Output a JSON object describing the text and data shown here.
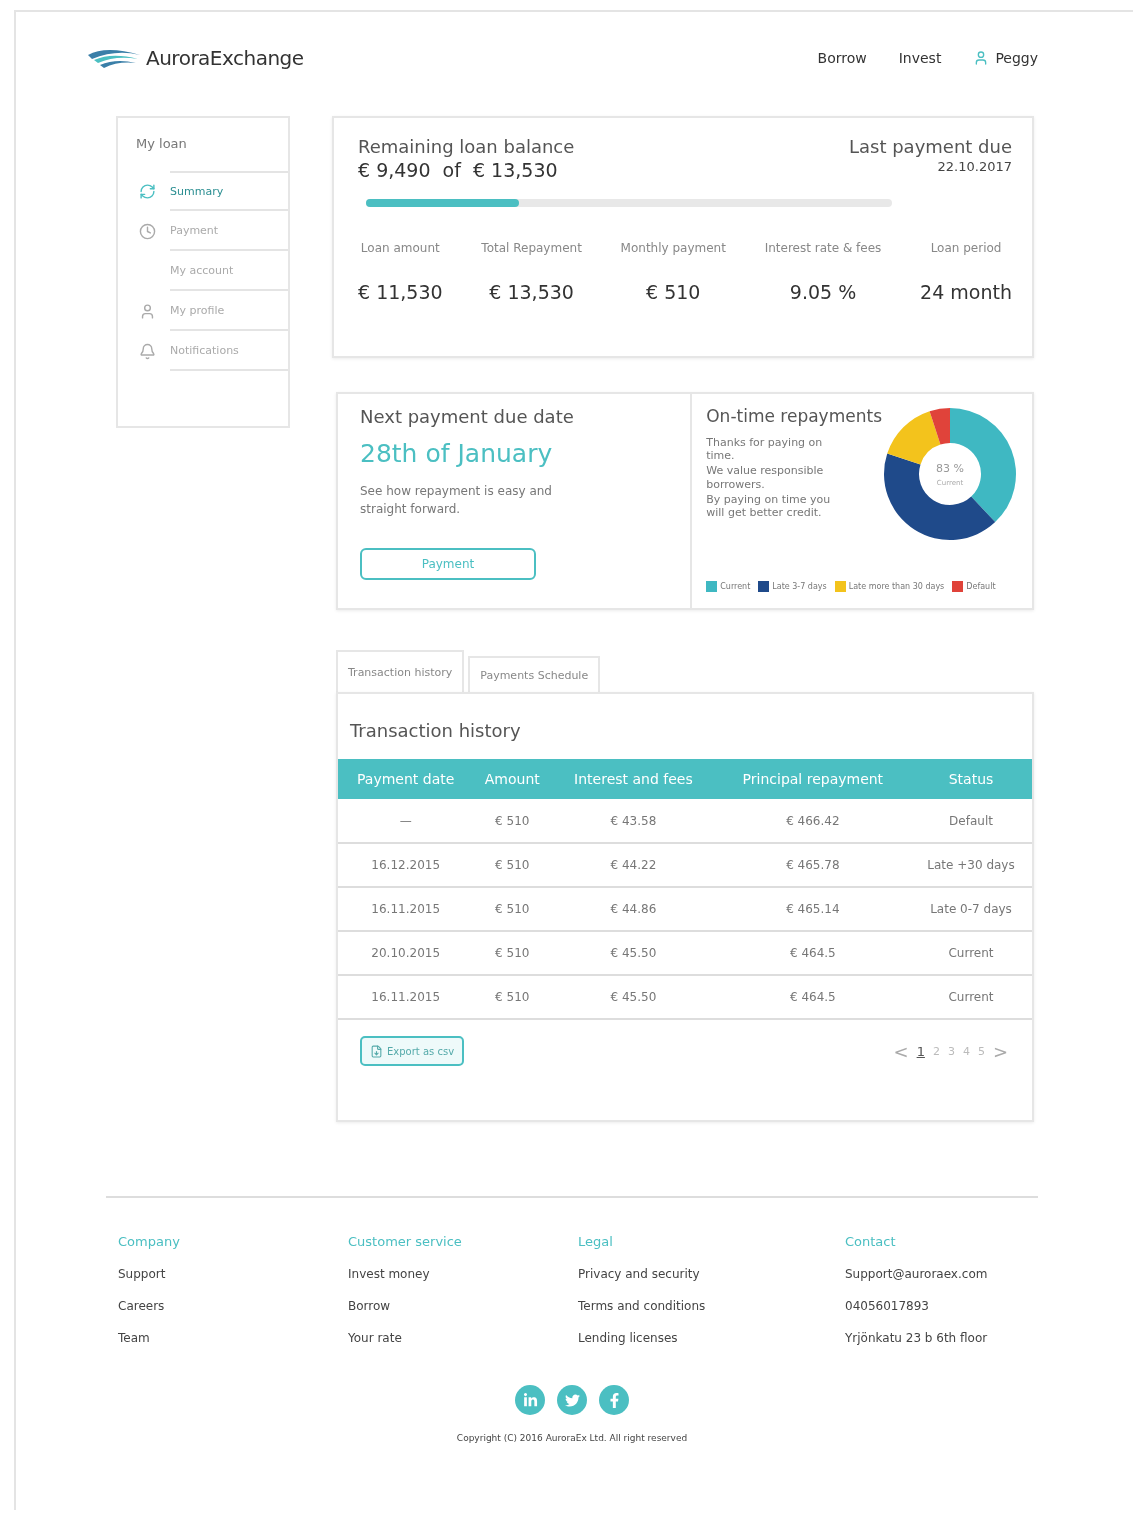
{
  "header": {
    "logo": "AuroraExchange",
    "nav": [
      {
        "label": "Borrow"
      },
      {
        "label": "Invest"
      }
    ],
    "user": "Peggy"
  },
  "sidebar": {
    "title": "My loan",
    "items": [
      {
        "label": "Summary",
        "selected": true,
        "kind": "refresh"
      },
      {
        "label": "Payment",
        "selected": false,
        "kind": "clock"
      },
      {
        "label": "My account",
        "selected": false,
        "kind": "none"
      },
      {
        "label": "My profile",
        "selected": false,
        "kind": "user"
      },
      {
        "label": "Notifications",
        "selected": false,
        "kind": "bell"
      }
    ]
  },
  "loan": {
    "balance_label": "Remaining loan balance",
    "balance": "€ 9,490  of  € 13,530",
    "due_label": "Last payment due",
    "due_date": "22.10.2017",
    "progress": {
      "level": 0.29
    },
    "stats": [
      {
        "label": "Loan amount",
        "value": "€ 11,530"
      },
      {
        "label": "Total Repayment",
        "value": "€ 13,530"
      },
      {
        "label": "Monthly payment",
        "value": "€ 510"
      },
      {
        "label": "Interest rate & fees",
        "value": "9.05 %"
      },
      {
        "label": "Loan period",
        "value": "24 month"
      }
    ]
  },
  "next_payment": {
    "title": "Next payment due date",
    "date": "28th of January",
    "text": "See how repayment is easy and straight forward.",
    "button": "Payment"
  },
  "repayments": {
    "title": "On-time repayments",
    "lines": [
      "Thanks for paying on time.",
      "We value responsible borrowers.",
      "By paying on time you will get better credit."
    ],
    "center_value": "83 %",
    "center_label": "Current",
    "legend": [
      {
        "label": "Current",
        "color": "#3fb8c2"
      },
      {
        "label": "Late 3-7 days",
        "color": "#1f4a8a"
      },
      {
        "label": "Late more than 30 days",
        "color": "#f3c31c"
      },
      {
        "label": "Default",
        "color": "#e0433a"
      }
    ]
  },
  "tabs": [
    {
      "label": "Transaction history",
      "selected": true
    },
    {
      "label": "Payments Schedule",
      "selected": false
    }
  ],
  "transactions": {
    "title": "Transaction history",
    "columns": [
      "Payment date",
      "Amount",
      "Interest and fees",
      "Principal repayment",
      "Status"
    ],
    "rows": [
      [
        "—",
        "€ 510",
        "€ 43.58",
        "€ 466.42",
        "Default"
      ],
      [
        "16.12.2015",
        "€ 510",
        "€ 44.22",
        "€ 465.78",
        "Late +30 days"
      ],
      [
        "16.11.2015",
        "€ 510",
        "€ 44.86",
        "€ 465.14",
        "Late 0-7 days"
      ],
      [
        "20.10.2015",
        "€ 510",
        "€ 45.50",
        "€ 464.5",
        "Current"
      ],
      [
        "16.11.2015",
        "€ 510",
        "€ 45.50",
        "€ 464.5",
        "Current"
      ]
    ],
    "export_button": "Export as csv",
    "pagination": {
      "prev": "<",
      "next": ">",
      "pages": [
        {
          "label": "1",
          "selected": true
        },
        {
          "label": "2",
          "selected": false
        },
        {
          "label": "3",
          "selected": false
        },
        {
          "label": "4",
          "selected": false
        },
        {
          "label": "5",
          "selected": false
        }
      ]
    }
  },
  "footer": {
    "columns": [
      {
        "heading": "Company",
        "links": [
          "Support",
          "Careers",
          "Team"
        ]
      },
      {
        "heading": "Customer service",
        "links": [
          "Invest money",
          "Borrow",
          "Your rate"
        ]
      },
      {
        "heading": "Legal",
        "links": [
          "Privacy and security",
          "Terms and conditions",
          "Lending licenses"
        ]
      },
      {
        "heading": "Contact",
        "links": [
          "Support@auroraex.com",
          "04056017893",
          "Yrjönkatu 23 b 6th floor"
        ]
      }
    ],
    "social": [
      {
        "kind": "linkedin"
      },
      {
        "kind": "twitter"
      },
      {
        "kind": "facebook"
      }
    ],
    "copyright": "Copyright (C) 2016 AuroraEx Ltd. All right reserved"
  }
}
